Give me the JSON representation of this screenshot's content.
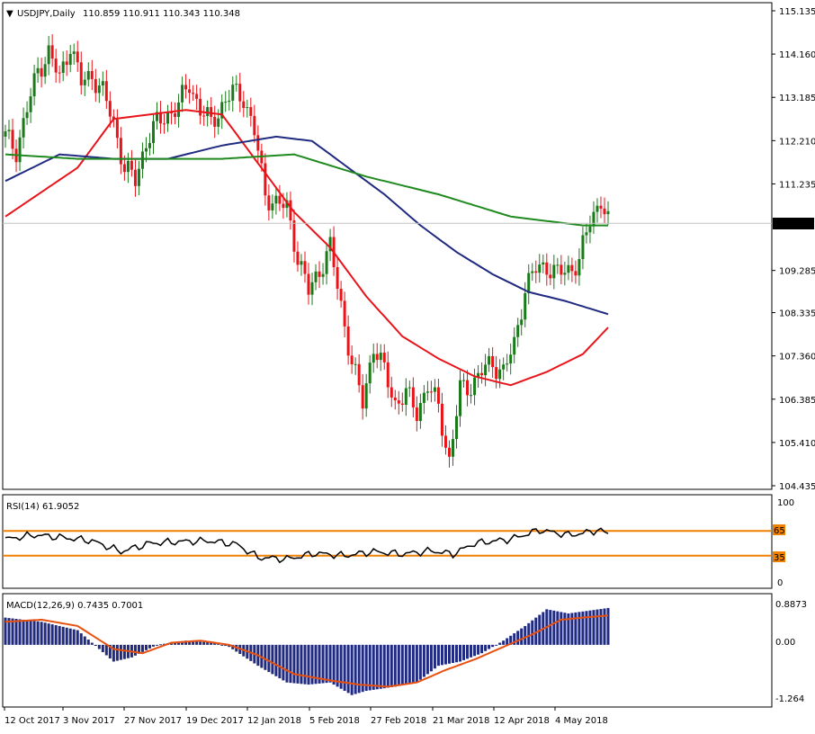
{
  "header": {
    "symbol_label": "USDJPY,Daily",
    "ohlc": "110.859 110.911 110.343 110.348"
  },
  "price_axis": {
    "ticks": [
      "115.135",
      "114.160",
      "113.185",
      "112.210",
      "111.235",
      "110.348",
      "109.285",
      "108.335",
      "107.360",
      "106.385",
      "105.410",
      "104.435"
    ],
    "current_price": "110.348"
  },
  "x_axis": {
    "ticks": [
      "12 Oct 2017",
      "3 Nov 2017",
      "27 Nov 2017",
      "19 Dec 2017",
      "12 Jan 2018",
      "5 Feb 2018",
      "27 Feb 2018",
      "21 Mar 2018",
      "12 Apr 2018",
      "4 May 2018"
    ]
  },
  "rsi": {
    "label": "RSI(14) 61.9052",
    "ticks": [
      "100",
      "65",
      "35",
      "0"
    ]
  },
  "macd": {
    "label": "MACD(12,26,9) 0.7435 0.7001",
    "ticks": [
      "0.8873",
      "0.00",
      "-1.264"
    ]
  },
  "colors": {
    "up": "#1a7a1a",
    "down": "#e8141a",
    "ma_fast": "#e8141a",
    "ma_mid": "#1f2a80",
    "ma_slow": "#1e8a1e",
    "rsi_level": "#f08000",
    "macd_hist": "#1f2a80",
    "macd_signal": "#e85010"
  },
  "chart_data": {
    "type": "candlestick",
    "symbol": "USDJPY",
    "timeframe": "Daily",
    "ylim": [
      104.435,
      115.135
    ],
    "close_path": [
      [
        0,
        112.3
      ],
      [
        3,
        112.0
      ],
      [
        6,
        112.9
      ],
      [
        9,
        113.8
      ],
      [
        12,
        114.2
      ],
      [
        15,
        113.6
      ],
      [
        18,
        114.4
      ],
      [
        21,
        113.5
      ],
      [
        24,
        113.7
      ],
      [
        27,
        113.3
      ],
      [
        30,
        112.6
      ],
      [
        33,
        111.6
      ],
      [
        36,
        111.3
      ],
      [
        39,
        112.2
      ],
      [
        42,
        112.6
      ],
      [
        45,
        112.8
      ],
      [
        48,
        113.0
      ],
      [
        51,
        113.5
      ],
      [
        54,
        112.9
      ],
      [
        57,
        112.6
      ],
      [
        60,
        113.0
      ],
      [
        63,
        113.3
      ],
      [
        66,
        113.2
      ],
      [
        69,
        112.4
      ],
      [
        72,
        111.0
      ],
      [
        75,
        110.8
      ],
      [
        78,
        110.7
      ],
      [
        81,
        109.6
      ],
      [
        84,
        108.8
      ],
      [
        87,
        109.3
      ],
      [
        90,
        109.8
      ],
      [
        93,
        108.5
      ],
      [
        96,
        107.2
      ],
      [
        99,
        106.3
      ],
      [
        102,
        107.6
      ],
      [
        105,
        107.0
      ],
      [
        108,
        106.3
      ],
      [
        111,
        106.5
      ],
      [
        114,
        106.1
      ],
      [
        117,
        106.7
      ],
      [
        120,
        106.2
      ],
      [
        123,
        105.0
      ],
      [
        126,
        106.6
      ],
      [
        129,
        106.7
      ],
      [
        132,
        107.0
      ],
      [
        135,
        107.2
      ],
      [
        138,
        107.0
      ],
      [
        141,
        107.6
      ],
      [
        144,
        108.9
      ],
      [
        147,
        109.3
      ],
      [
        150,
        109.4
      ],
      [
        153,
        109.2
      ],
      [
        156,
        109.3
      ],
      [
        159,
        109.5
      ],
      [
        162,
        110.4
      ],
      [
        165,
        110.9
      ],
      [
        167,
        110.35
      ]
    ],
    "series": [
      {
        "values_by_bar": [
          [
            0,
            110.5
          ],
          [
            20,
            111.6
          ],
          [
            30,
            112.7
          ],
          [
            40,
            112.8
          ],
          [
            50,
            112.9
          ],
          [
            60,
            112.8
          ],
          [
            70,
            111.7
          ],
          [
            80,
            110.6
          ],
          [
            90,
            109.8
          ],
          [
            100,
            108.7
          ],
          [
            110,
            107.8
          ],
          [
            120,
            107.3
          ],
          [
            130,
            106.9
          ],
          [
            140,
            106.7
          ],
          [
            150,
            107.0
          ],
          [
            160,
            107.4
          ],
          [
            167,
            108.0
          ]
        ]
      },
      {
        "values_by_bar": [
          [
            0,
            111.3
          ],
          [
            15,
            111.9
          ],
          [
            30,
            111.8
          ],
          [
            45,
            111.8
          ],
          [
            60,
            112.1
          ],
          [
            75,
            112.3
          ],
          [
            85,
            112.2
          ],
          [
            95,
            111.6
          ],
          [
            105,
            111.0
          ],
          [
            115,
            110.3
          ],
          [
            125,
            109.7
          ],
          [
            135,
            109.2
          ],
          [
            145,
            108.8
          ],
          [
            155,
            108.6
          ],
          [
            167,
            108.3
          ]
        ]
      },
      {
        "values_by_bar": [
          [
            0,
            111.9
          ],
          [
            20,
            111.8
          ],
          [
            40,
            111.8
          ],
          [
            60,
            111.8
          ],
          [
            80,
            111.9
          ],
          [
            100,
            111.4
          ],
          [
            120,
            111.0
          ],
          [
            140,
            110.5
          ],
          [
            150,
            110.4
          ],
          [
            160,
            110.3
          ],
          [
            167,
            110.3
          ]
        ]
      }
    ],
    "rsi": {
      "period": 14,
      "last": 61.9052,
      "levels": [
        65,
        35
      ],
      "ylim": [
        0,
        100
      ],
      "path": [
        [
          0,
          55
        ],
        [
          8,
          60
        ],
        [
          16,
          57
        ],
        [
          24,
          53
        ],
        [
          32,
          40
        ],
        [
          40,
          50
        ],
        [
          48,
          52
        ],
        [
          56,
          53
        ],
        [
          64,
          49
        ],
        [
          70,
          33
        ],
        [
          78,
          31
        ],
        [
          86,
          38
        ],
        [
          94,
          35
        ],
        [
          102,
          40
        ],
        [
          110,
          37
        ],
        [
          118,
          41
        ],
        [
          124,
          37
        ],
        [
          130,
          50
        ],
        [
          140,
          55
        ],
        [
          148,
          66
        ],
        [
          156,
          60
        ],
        [
          160,
          62
        ],
        [
          164,
          66
        ],
        [
          167,
          61.9
        ]
      ]
    },
    "macd": {
      "params": [
        12,
        26,
        9
      ],
      "main": 0.7435,
      "signal": 0.7001,
      "ylim": [
        -1.4,
        1.05
      ],
      "hist": [
        [
          0,
          0.65
        ],
        [
          10,
          0.55
        ],
        [
          20,
          0.35
        ],
        [
          30,
          -0.4
        ],
        [
          35,
          -0.3
        ],
        [
          42,
          0.0
        ],
        [
          50,
          0.1
        ],
        [
          58,
          0.05
        ],
        [
          62,
          -0.05
        ],
        [
          70,
          -0.5
        ],
        [
          78,
          -0.9
        ],
        [
          84,
          -0.95
        ],
        [
          90,
          -0.9
        ],
        [
          96,
          -1.2
        ],
        [
          100,
          -1.1
        ],
        [
          108,
          -1.0
        ],
        [
          114,
          -0.9
        ],
        [
          120,
          -0.5
        ],
        [
          126,
          -0.4
        ],
        [
          132,
          -0.2
        ],
        [
          138,
          0.1
        ],
        [
          144,
          0.45
        ],
        [
          150,
          0.85
        ],
        [
          156,
          0.75
        ],
        [
          162,
          0.82
        ],
        [
          167,
          0.88
        ]
      ],
      "signal_path": [
        [
          0,
          0.55
        ],
        [
          10,
          0.6
        ],
        [
          20,
          0.45
        ],
        [
          30,
          -0.1
        ],
        [
          38,
          -0.2
        ],
        [
          46,
          0.05
        ],
        [
          54,
          0.1
        ],
        [
          62,
          0.0
        ],
        [
          70,
          -0.25
        ],
        [
          80,
          -0.7
        ],
        [
          90,
          -0.85
        ],
        [
          98,
          -0.95
        ],
        [
          106,
          -1.0
        ],
        [
          114,
          -0.9
        ],
        [
          122,
          -0.6
        ],
        [
          130,
          -0.35
        ],
        [
          138,
          -0.05
        ],
        [
          146,
          0.25
        ],
        [
          154,
          0.6
        ],
        [
          160,
          0.65
        ],
        [
          167,
          0.7
        ]
      ]
    }
  }
}
